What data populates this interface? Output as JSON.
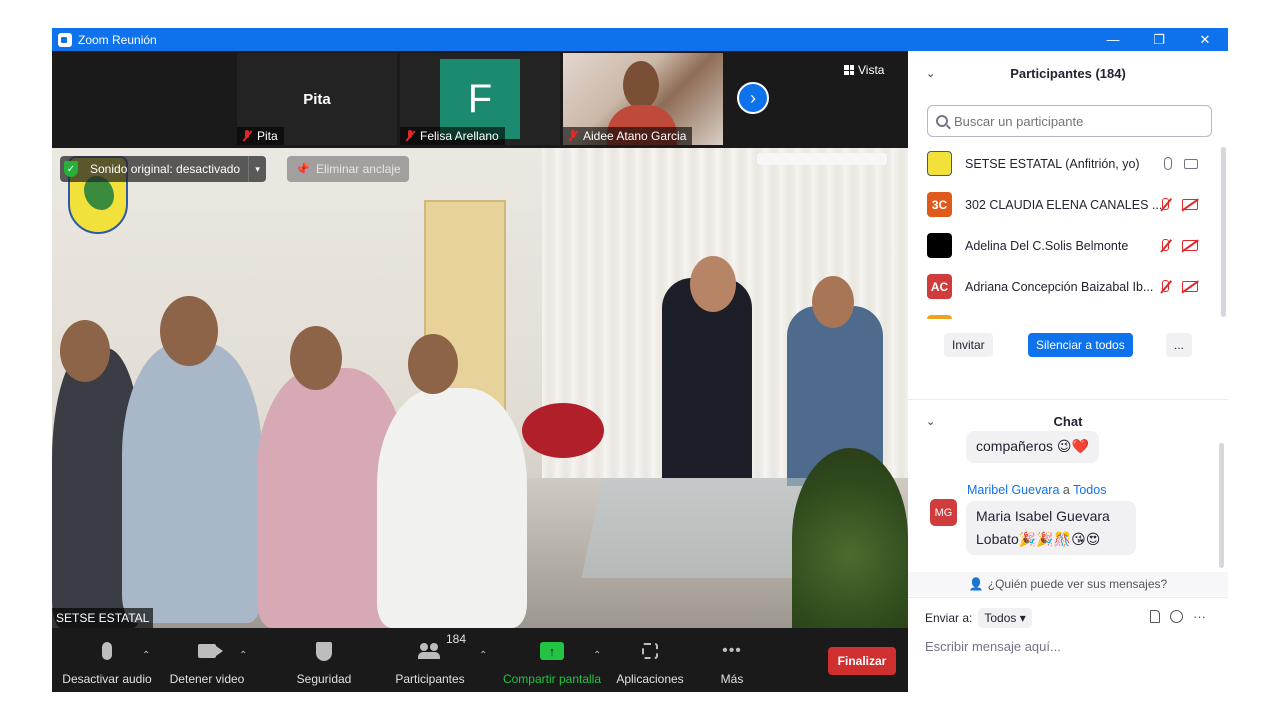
{
  "window": {
    "title": "Zoom Reunión",
    "controls": {
      "minimize": "—",
      "restore": "❐",
      "close": "✕"
    }
  },
  "thumbnails": [
    {
      "big_name": "Pita",
      "label": "Pita",
      "muted": true
    },
    {
      "avatar_letter": "F",
      "label": "Felisa Arellano",
      "avatar_color": "#1c8a6e",
      "muted": true
    },
    {
      "label": "Aidee Atano Garcia",
      "muted": true
    }
  ],
  "view_button": {
    "label": "Vista",
    "icon": "grid-icon"
  },
  "next_icon": "chevron-right-icon",
  "main_video": {
    "sound_label": "Sonido original: desactivado",
    "unpin_label": "Eliminar anclaje",
    "participant_name": "SETSE ESTATAL"
  },
  "toolbar": {
    "mute_label": "Desactivar audio",
    "video_label": "Detener video",
    "security_label": "Seguridad",
    "participants_label": "Participantes",
    "participants_count": "184",
    "share_label": "Compartir pantalla",
    "apps_label": "Aplicaciones",
    "more_label": "Más",
    "end_label": "Finalizar",
    "caret": "⌃",
    "share_color": "#23c343",
    "end_color": "#d02f2f"
  },
  "participants_panel": {
    "title": "Participantes (184)",
    "search_placeholder": "Buscar un participante",
    "items": [
      {
        "avatar": "",
        "avatar_color": "#f3e13b",
        "name": "SETSE ESTATAL (Anfitrión, yo)",
        "muted": false
      },
      {
        "avatar": "3C",
        "avatar_color": "#e05a1c",
        "name": "302 CLAUDIA ELENA CANALES ...",
        "muted": true
      },
      {
        "avatar": "",
        "avatar_color": "#000000",
        "name": "Adelina Del C.Solis Belmonte",
        "muted": true
      },
      {
        "avatar": "AC",
        "avatar_color": "#d03b3b",
        "name": "Adriana Concepción Baizabal Ib...",
        "muted": true
      }
    ],
    "invite_label": "Invitar",
    "mute_all_label": "Silenciar a todos",
    "more_label": "..."
  },
  "chat_panel": {
    "title": "Chat",
    "partial_message": "compañeros 😉❤️",
    "sender_name": "Maribel Guevara",
    "sender_connector": "a",
    "sender_target": "Todos",
    "sender_avatar": "MG",
    "message": "Maria Isabel Guevara Lobato🎉🎉🎊😘😍",
    "who_sees": "¿Quién puede ver sus mensajes?",
    "send_to_label": "Enviar a:",
    "send_to_value": "Todos",
    "input_placeholder": "Escribir mensaje aquí...",
    "more_icon": "···"
  }
}
